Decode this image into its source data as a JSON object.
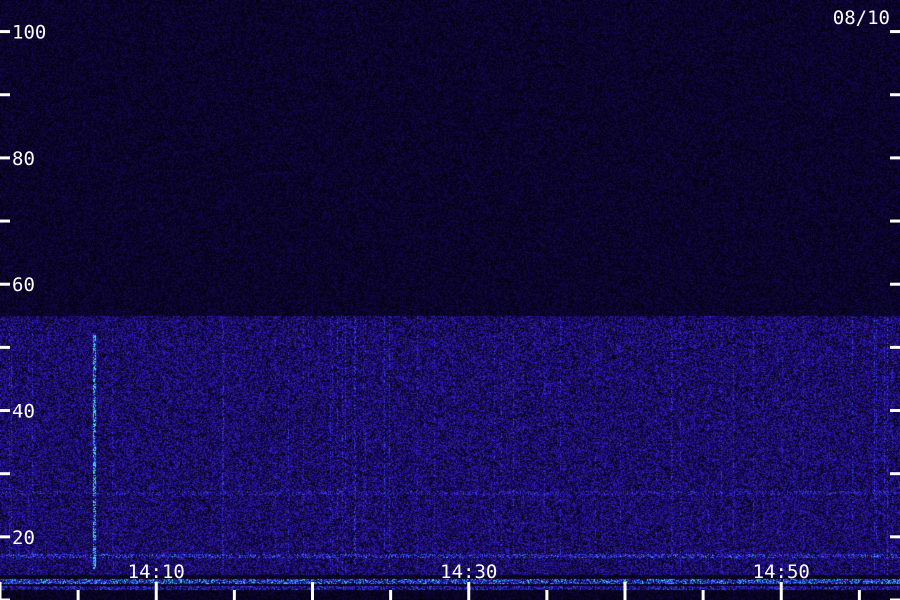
{
  "chart_data": {
    "type": "heatmap",
    "title": "",
    "date_label": "08/10",
    "xlabel": "",
    "ylabel": "",
    "x_tick_labels": [
      "14:10",
      "14:30",
      "14:50"
    ],
    "x_range_minutes": [
      14.0,
      14.96
    ],
    "y_tick_labels": [
      "20",
      "40",
      "60",
      "80",
      "100"
    ],
    "y_tick_values": [
      20,
      40,
      60,
      80,
      100
    ],
    "ylim": [
      10,
      105
    ],
    "colormap": [
      "#000000",
      "#1a0a6a",
      "#3a22d8",
      "#2a7aff",
      "#3ff0d8"
    ],
    "features": [
      {
        "kind": "noise-floor",
        "y_range": [
          55,
          105
        ],
        "level": 0.15
      },
      {
        "kind": "band",
        "y_range": [
          14,
          55
        ],
        "level": 0.35
      },
      {
        "kind": "horizontal-line",
        "y": 27,
        "level": 0.55
      },
      {
        "kind": "horizontal-line",
        "y": 17,
        "level": 0.7
      },
      {
        "kind": "horizontal-line",
        "y": 13,
        "level": 0.9
      },
      {
        "kind": "horizontal-line",
        "y": 12,
        "level": 0.6
      },
      {
        "kind": "vertical-burst",
        "time": "14:06",
        "y_range": [
          15,
          52
        ],
        "level": 1.0
      }
    ]
  }
}
